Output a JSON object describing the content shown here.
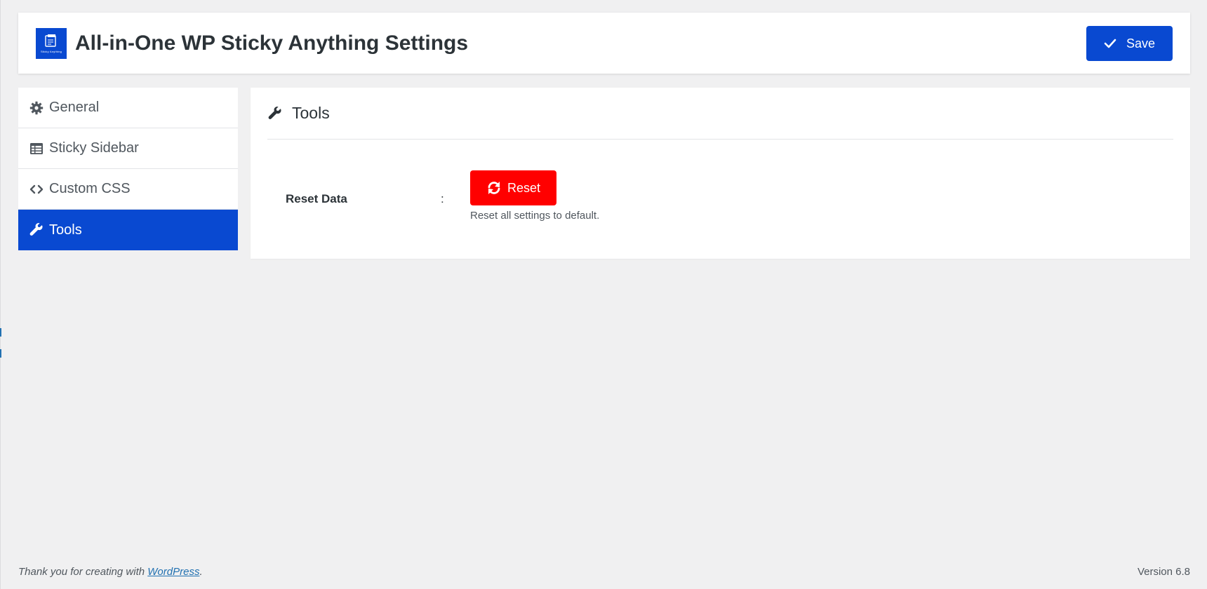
{
  "header": {
    "title": "All-in-One WP Sticky Anything Settings",
    "logo_text": "Sticky Anything",
    "save_label": "Save"
  },
  "sidebar": {
    "items": [
      {
        "label": "General",
        "icon": "gear-icon",
        "active": false
      },
      {
        "label": "Sticky Sidebar",
        "icon": "table-icon",
        "active": false
      },
      {
        "label": "Custom CSS",
        "icon": "code-icon",
        "active": false
      },
      {
        "label": "Tools",
        "icon": "wrench-icon",
        "active": true
      }
    ]
  },
  "main": {
    "title": "Tools",
    "title_icon": "wrench-icon",
    "reset_label": "Reset Data",
    "colon": ":",
    "reset_button": "Reset",
    "reset_description": "Reset all settings to default."
  },
  "footer": {
    "thanks_prefix": "Thank you for creating with ",
    "thanks_link": "WordPress",
    "thanks_suffix": ".",
    "version": "Version 6.8"
  },
  "colors": {
    "accent": "#0949d1",
    "danger": "#ff0000",
    "background": "#f0f0f1"
  }
}
